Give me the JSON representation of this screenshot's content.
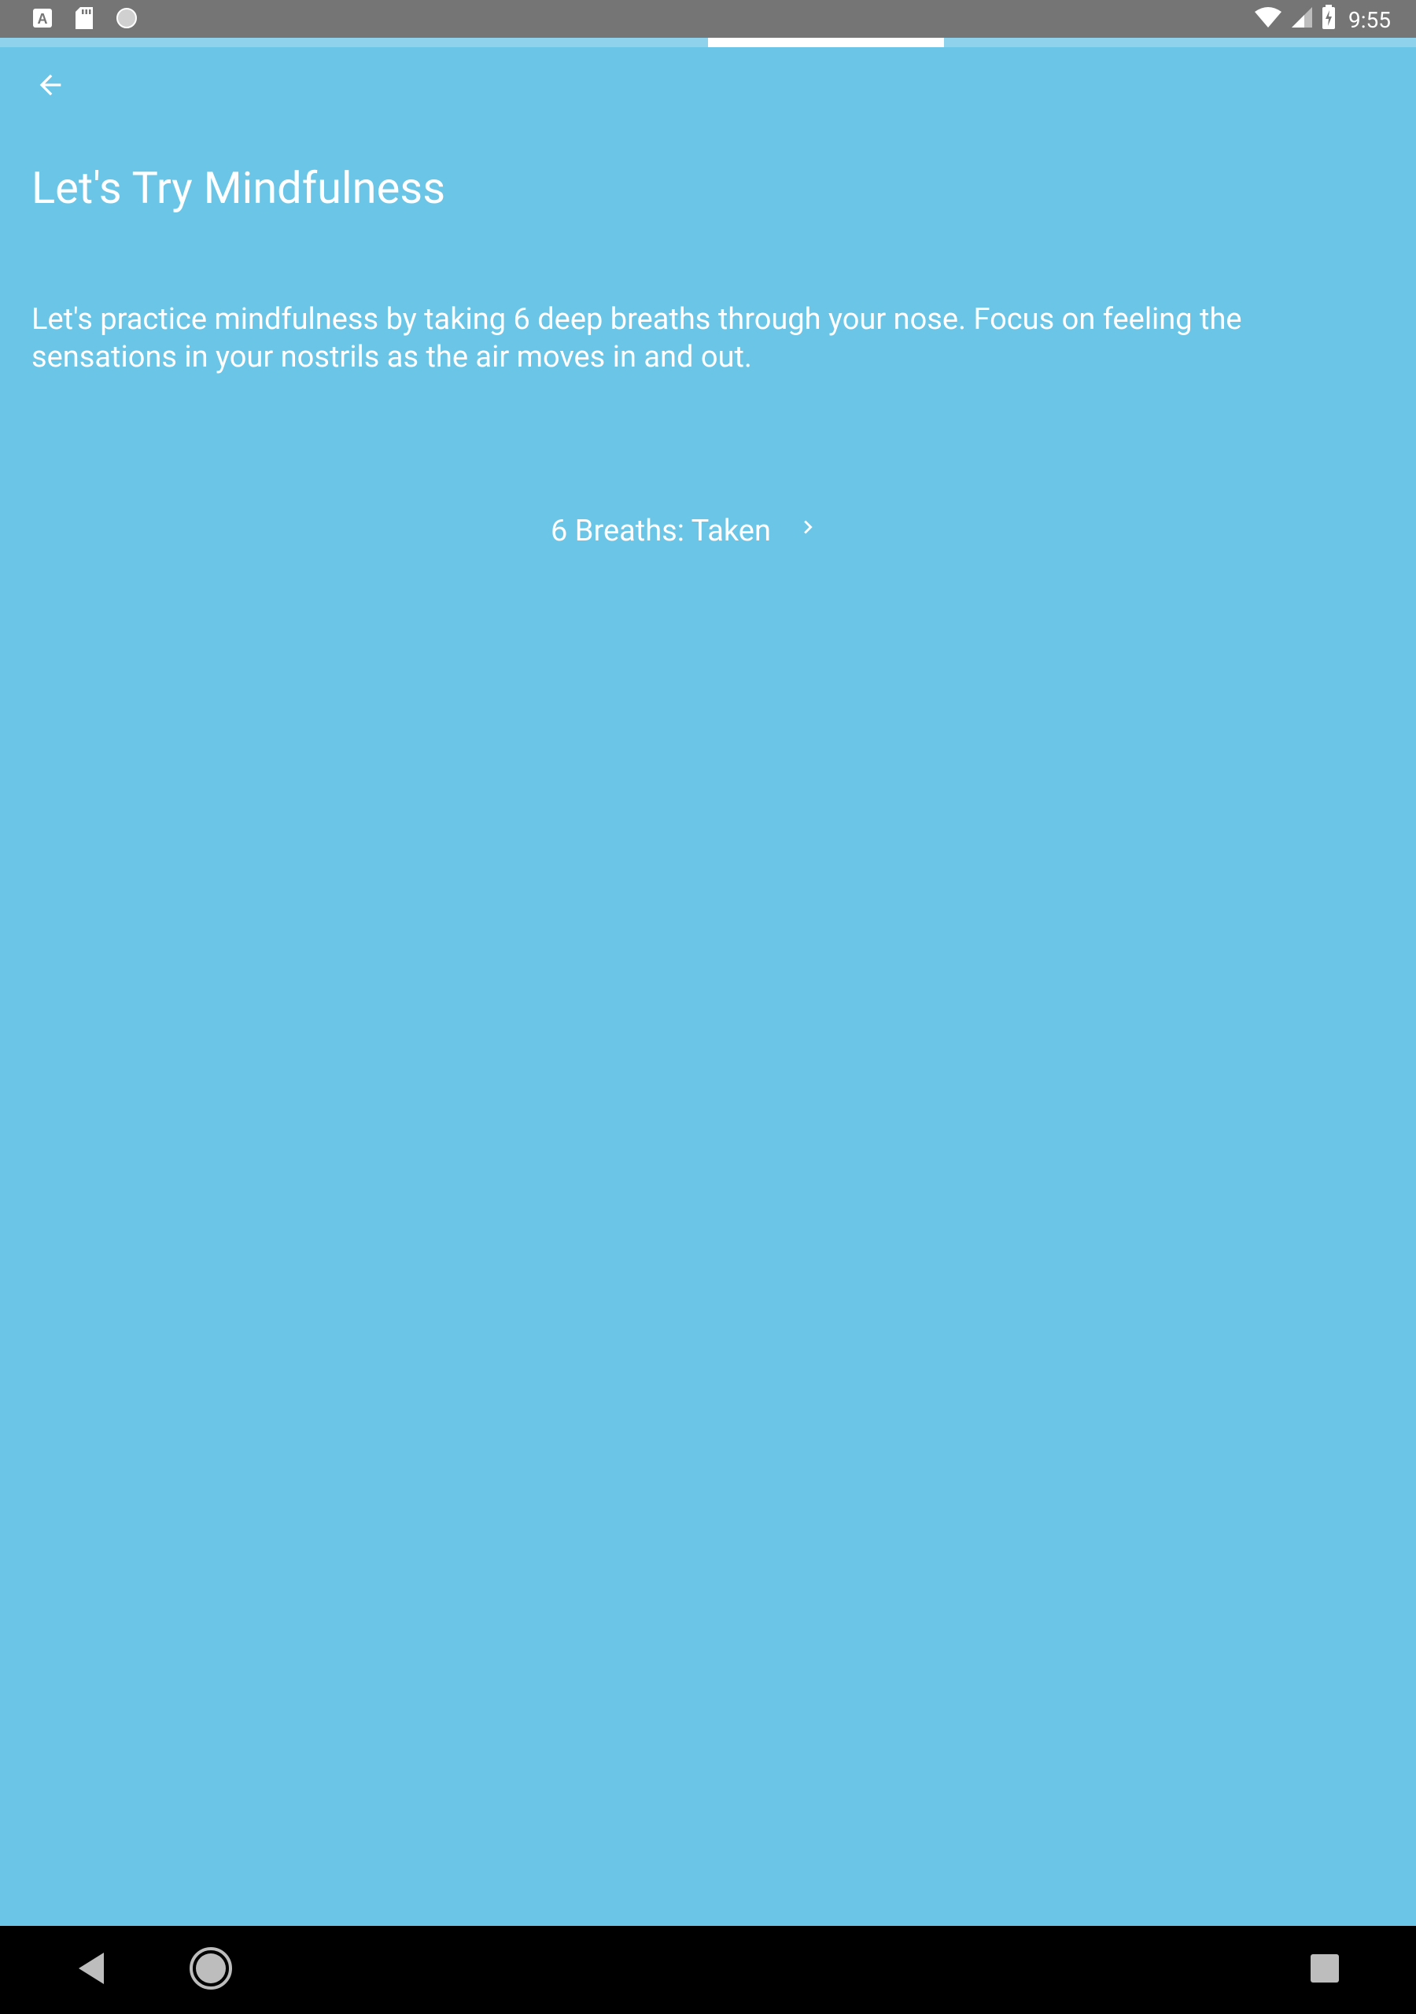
{
  "status_bar": {
    "time": "9:55",
    "left_icons": [
      "keyboard-a-icon",
      "sd-card-icon",
      "sync-circle-icon"
    ],
    "right_icons": [
      "wifi-icon",
      "signal-icon",
      "battery-charging-icon"
    ]
  },
  "progress": {
    "current_step": 4,
    "total_steps": 6
  },
  "header": {
    "back_icon": "arrow-back-icon"
  },
  "main": {
    "title": "Let's Try Mindfulness",
    "description": "Let's practice mindfulness by taking 6 deep breaths through your nose. Focus on feeling the sensations in your nostrils as the air moves in and out.",
    "breaths_button_label": "6 Breaths: Taken",
    "breaths_button_icon": "chevron-right-icon"
  },
  "nav_bar": {
    "items": [
      "nav-back-icon",
      "nav-home-icon",
      "nav-recents-icon"
    ]
  },
  "colors": {
    "background": "#6ac5e6",
    "status_bar": "#757575",
    "progress_track": "#8fd2ec",
    "progress_active": "#ffffff",
    "text": "#ffffff",
    "nav_bar": "#000000"
  }
}
